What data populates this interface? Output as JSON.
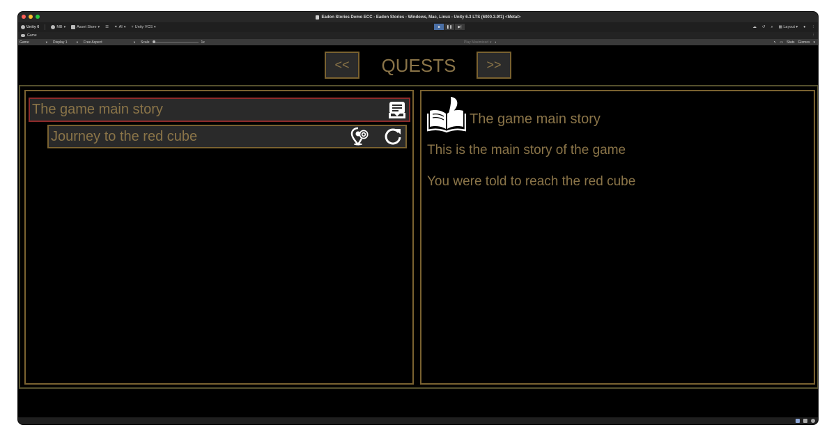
{
  "window": {
    "title": "Eadon Stories Demo ECC - Eadon Stories - Windows, Mac, Linux - Unity 6.3 LTS (6000.3.9f1) <Metal>"
  },
  "toolbar": {
    "unity": "Unity 6",
    "account": "MB",
    "asset_store": "Asset Store",
    "ai": "AI",
    "vcs": "Unity VCS",
    "layout": "Layout"
  },
  "tabs": {
    "game": "Game"
  },
  "game_controls": {
    "mode": "Game",
    "display": "Display 1",
    "aspect": "Free Aspect",
    "scale_label": "Scale",
    "scale_value": "1x",
    "play_maximized": "Play Maximized",
    "stats": "Stats",
    "gizmos": "Gizmos"
  },
  "quests_ui": {
    "title": "QUESTS",
    "prev": "<<",
    "next": ">>",
    "list": [
      {
        "label": "The game main story"
      },
      {
        "label": "Journey to the red cube"
      }
    ],
    "detail": {
      "title": "The game main story",
      "description": "This is the main story of the game",
      "objective": "You were told to reach the red cube"
    }
  },
  "colors": {
    "gold_text": "#8a7448",
    "gold_border": "#7a6230",
    "selected_border": "#8d2a2a",
    "row_bg": "#2a2a2a"
  }
}
